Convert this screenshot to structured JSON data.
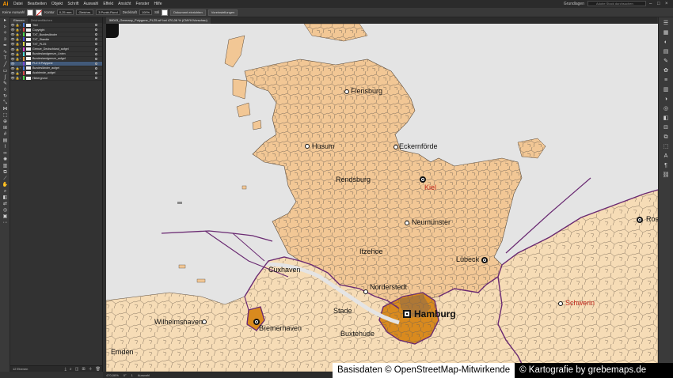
{
  "app": {
    "logo": "Ai",
    "menus": [
      "Datei",
      "Bearbeiten",
      "Objekt",
      "Schrift",
      "Auswahl",
      "Effekt",
      "Ansicht",
      "Fenster",
      "Hilfe"
    ],
    "workspace": "Grundlagen",
    "search_placeholder": "Adobe Stock durchsuchen"
  },
  "control_bar": {
    "selection_label": "Keine Auswahl",
    "stroke_label": "Kontur",
    "stroke_value": "0,25 mm",
    "stroke_style": "Gleichm.",
    "brush": "3 Punkt-Rund",
    "opacity_label": "Deckkraft",
    "opacity_value": "100%",
    "style_label": "Stil",
    "doc_setup_button": "Dokument einrichten",
    "preferences_button": "Voreinstellungen"
  },
  "layers_panel": {
    "tabs": [
      "Ebenen",
      "Zeichenflächen"
    ],
    "layers": [
      {
        "name": "Titel",
        "color": "#4a7bd6",
        "locked": true,
        "selected": false
      },
      {
        "name": "Copyright",
        "color": "#d64a4a",
        "locked": true,
        "selected": false
      },
      {
        "name": "TXT_Bundesländer",
        "color": "#4ad64a",
        "locked": true,
        "selected": false
      },
      {
        "name": "TXT_Staedte",
        "color": "#4a4ad6",
        "locked": true,
        "selected": false
      },
      {
        "name": "TXT_PLZ5",
        "color": "#d6d64a",
        "locked": true,
        "selected": false
      },
      {
        "name": "Grenze_Deutschland_aufgel",
        "color": "#d64ad6",
        "locked": true,
        "selected": false
      },
      {
        "name": "Bundeslandgrenze_Linien",
        "color": "#4ad6d6",
        "locked": true,
        "selected": false
      },
      {
        "name": "Bundeslandgrenze_aufgel",
        "color": "#d6954a",
        "locked": true,
        "selected": false
      },
      {
        "name": "PLZ 5 Polygone",
        "color": "#7a4ad6",
        "locked": false,
        "selected": true
      },
      {
        "name": "Bundesländer_aufgel",
        "color": "#4a7bd6",
        "locked": true,
        "selected": false
      },
      {
        "name": "Ausblende_aufgel",
        "color": "#d64a4a",
        "locked": true,
        "selected": false
      },
      {
        "name": "Hintergrund",
        "color": "#4ad64a",
        "locked": true,
        "selected": false
      }
    ],
    "footer_count": "12 Ebenen"
  },
  "document": {
    "tab_title": "58043_Germany_Polygone_PLZ5.ai* bei 470,06 % (CMYK/Vorschau)"
  },
  "status_bar": {
    "zoom": "470,06%",
    "rotation": "0°",
    "artboard": "1",
    "tool": "Auswahl"
  },
  "map": {
    "cities": [
      {
        "name": "Flensburg",
        "color": "#111111"
      },
      {
        "name": "Husum",
        "color": "#111111"
      },
      {
        "name": "Eckernförde",
        "color": "#111111"
      },
      {
        "name": "Rendsburg",
        "color": "#111111"
      },
      {
        "name": "Kiel",
        "color": "#c0281c"
      },
      {
        "name": "Neumünster",
        "color": "#111111"
      },
      {
        "name": "Itzehoe",
        "color": "#111111"
      },
      {
        "name": "Lübeck",
        "color": "#111111"
      },
      {
        "name": "Cuxhaven",
        "color": "#111111"
      },
      {
        "name": "Norderstedt",
        "color": "#111111"
      },
      {
        "name": "Hamburg",
        "color": "#111111"
      },
      {
        "name": "Schwerin",
        "color": "#c0281c"
      },
      {
        "name": "Wilhelmshaven",
        "color": "#111111"
      },
      {
        "name": "Bremerhaven",
        "color": "#111111"
      },
      {
        "name": "Stade",
        "color": "#111111"
      },
      {
        "name": "Buxtehude",
        "color": "#111111"
      },
      {
        "name": "Emden",
        "color": "#111111"
      },
      {
        "name": "Ros",
        "color": "#111111"
      }
    ],
    "colors": {
      "water": "#e4e4e4",
      "land": "#f2c795",
      "land_other": "#f6dcb6",
      "hamburg": "#d98a1e",
      "border": "#6a2a72"
    }
  },
  "credits": {
    "left": "Basisdaten © OpenStreetMap-Mitwirkende",
    "right": "© Kartografie by grebemaps.de"
  }
}
